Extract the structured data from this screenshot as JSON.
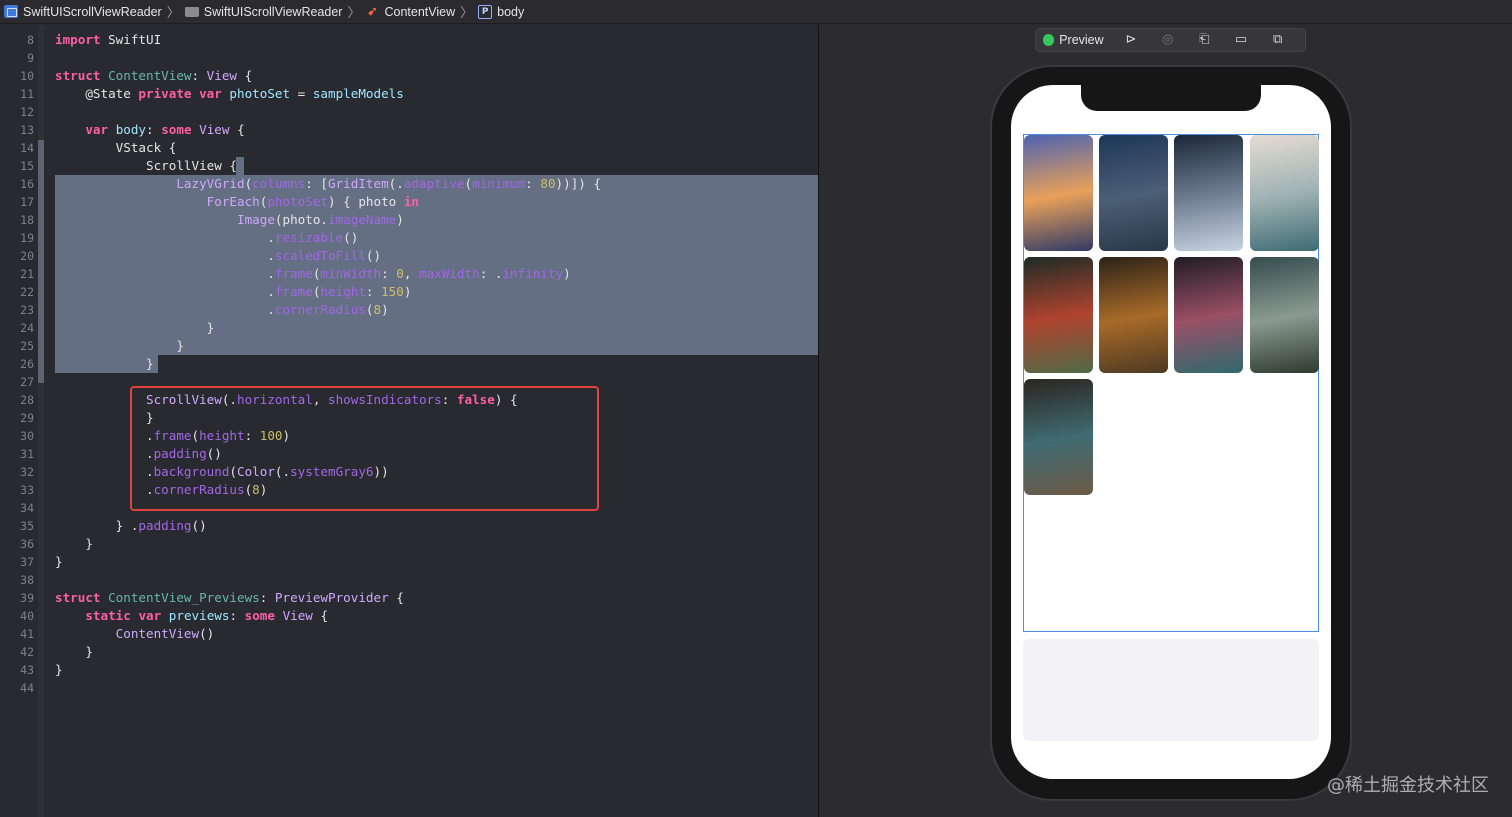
{
  "breadcrumb": {
    "project": "SwiftUIScrollViewReader",
    "folder": "SwiftUIScrollViewReader",
    "file": "ContentView",
    "property": "body",
    "property_badge": "P"
  },
  "editor": {
    "line_numbers": [
      "8",
      "9",
      "10",
      "11",
      "12",
      "13",
      "14",
      "15",
      "16",
      "17",
      "18",
      "19",
      "20",
      "21",
      "22",
      "23",
      "24",
      "25",
      "26",
      "27",
      "28",
      "29",
      "30",
      "31",
      "32",
      "33",
      "34",
      "35",
      "36",
      "37",
      "38",
      "39",
      "40",
      "41",
      "42",
      "43",
      "44"
    ]
  },
  "code": {
    "l8": [
      "import",
      " SwiftUI"
    ],
    "l10": [
      "struct",
      " ",
      "ContentView",
      ": ",
      "View",
      " {"
    ],
    "l11": [
      "    @State ",
      "private",
      " ",
      "var",
      " ",
      "photoSet",
      " = ",
      "sampleModels"
    ],
    "l13": [
      "    ",
      "var",
      " ",
      "body",
      ": ",
      "some",
      " ",
      "View",
      " {"
    ],
    "l14": [
      "        ",
      "VStack",
      " {"
    ],
    "l15": [
      "            ",
      "ScrollView",
      " {"
    ],
    "l16": [
      "                ",
      "LazyVGrid",
      "(",
      "columns",
      ": [",
      "GridItem",
      "(.",
      "adaptive",
      "(",
      "minimum",
      ": ",
      "80",
      "))]) {"
    ],
    "l17": [
      "                    ",
      "ForEach",
      "(",
      "photoSet",
      ") { photo ",
      "in"
    ],
    "l18": [
      "                        ",
      "Image",
      "(photo.",
      "imageName",
      ")"
    ],
    "l19": [
      "                            .",
      "resizable",
      "()"
    ],
    "l20": [
      "                            .",
      "scaledToFill",
      "()"
    ],
    "l21": [
      "                            .",
      "frame",
      "(",
      "minWidth",
      ": ",
      "0",
      ", ",
      "maxWidth",
      ": .",
      "infinity",
      ")"
    ],
    "l22": [
      "                            .",
      "frame",
      "(",
      "height",
      ": ",
      "150",
      ")"
    ],
    "l23": [
      "                            .",
      "cornerRadius",
      "(",
      "8",
      ")"
    ],
    "l24": [
      "                    }"
    ],
    "l25": [
      "                }"
    ],
    "l26": [
      "            }"
    ],
    "l28": [
      "            ",
      "ScrollView",
      "(.",
      "horizontal",
      ", ",
      "showsIndicators",
      ": ",
      "false",
      ") {"
    ],
    "l29": [
      "            }"
    ],
    "l30": [
      "            .",
      "frame",
      "(",
      "height",
      ": ",
      "100",
      ")"
    ],
    "l31": [
      "            .",
      "padding",
      "()"
    ],
    "l32": [
      "            .",
      "background",
      "(",
      "Color",
      "(.",
      "systemGray6",
      "))"
    ],
    "l33": [
      "            .",
      "cornerRadius",
      "(",
      "8",
      ")"
    ],
    "l35": [
      "        } .",
      "padding",
      "()"
    ],
    "l36": [
      "    }"
    ],
    "l37": [
      "}"
    ],
    "l39": [
      "struct",
      " ",
      "ContentView_Previews",
      ": ",
      "PreviewProvider",
      " {"
    ],
    "l40": [
      "    ",
      "static",
      " ",
      "var",
      " ",
      "previews",
      ": ",
      "some",
      " ",
      "View",
      " {"
    ],
    "l41": [
      "        ",
      "ContentView",
      "()"
    ],
    "l42": [
      "    }"
    ],
    "l43": [
      "}"
    ]
  },
  "canvas": {
    "preview_label": "Preview",
    "toolbar_icons": [
      "live-preview-icon",
      "inspect-icon",
      "rotate-device-icon",
      "device-settings-icon",
      "duplicate-preview-icon"
    ]
  },
  "photos": [
    {
      "name": "lake-castle-sunset",
      "colors": [
        "#4d63b0",
        "#e9a05a",
        "#303a66"
      ]
    },
    {
      "name": "blue-cliff",
      "colors": [
        "#1d3658",
        "#4b5f76",
        "#283848"
      ]
    },
    {
      "name": "snowy-mountain-village",
      "colors": [
        "#1b2738",
        "#6f7d92",
        "#c9d4e2"
      ]
    },
    {
      "name": "misty-valley",
      "colors": [
        "#e5dcd2",
        "#9eb2b3",
        "#3e6b73"
      ]
    },
    {
      "name": "autumn-forest-aerial",
      "colors": [
        "#1d2b26",
        "#b0432e",
        "#4f6a46"
      ]
    },
    {
      "name": "forest-road-aerial",
      "colors": [
        "#2b2218",
        "#a86a28",
        "#4d3a22"
      ]
    },
    {
      "name": "dark-coral-forest",
      "colors": [
        "#201d24",
        "#9a4f66",
        "#2f6a6e"
      ]
    },
    {
      "name": "waterfall-cave",
      "colors": [
        "#354d4e",
        "#8a9a90",
        "#2d3a2e"
      ]
    },
    {
      "name": "river-canyon",
      "colors": [
        "#2b2520",
        "#3f6b72",
        "#6d5a46"
      ]
    }
  ],
  "watermark": "@稀土掘金技术社区"
}
